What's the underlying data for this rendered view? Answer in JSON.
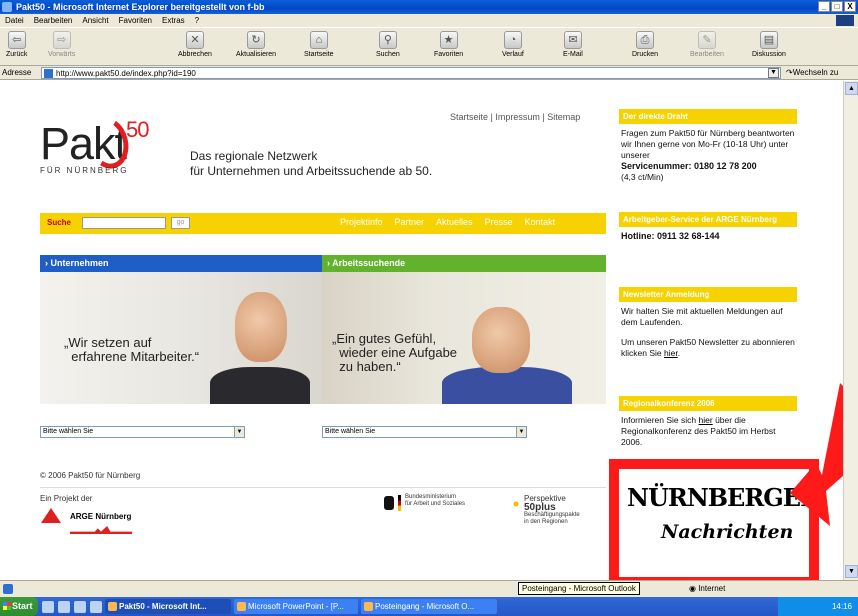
{
  "window": {
    "title": "Pakt50 - Microsoft Internet Explorer bereitgestellt von f-bb",
    "min": "_",
    "max": "□",
    "close": "X"
  },
  "menu": [
    "Datei",
    "Bearbeiten",
    "Ansicht",
    "Favoriten",
    "Extras",
    "?"
  ],
  "toolbar": {
    "back": "Zurück",
    "forward": "Vorwärts",
    "stop": "Abbrechen",
    "refresh": "Aktualisieren",
    "home": "Startseite",
    "search": "Suchen",
    "favorites": "Favoriten",
    "history": "Verlauf",
    "mail": "E-Mail",
    "print": "Drucken",
    "edit": "Bearbeiten",
    "discuss": "Diskussion"
  },
  "address": {
    "label": "Adresse",
    "url": "http://www.pakt50.de/index.php?id=190",
    "go": "Wechseln zu"
  },
  "page": {
    "toplinks": "Startseite | Impressum | Sitemap",
    "logo_text": "Pakt",
    "logo_sup": "50",
    "logo_sub": "FÜR NÜRNBERG",
    "tagline_1": "Das regionale Netzwerk",
    "tagline_2": "für Unternehmen und Arbeitssuchende ab 50.",
    "search_label": "Suche",
    "search_go": "go",
    "nav": [
      "Projektinfo",
      "Partner",
      "Aktuelles",
      "Presse",
      "Kontakt"
    ],
    "tab_left": "› Unternehmen",
    "tab_right": "› Arbeitssuchende",
    "quote_left": "„Wir setzen auf\n  erfahrene Mitarbeiter.“",
    "quote_right": "„Ein gutes Gefühl,\n  wieder eine Aufgabe\n  zu haben.“",
    "select_left": "Bitte wählen Sie",
    "select_right": "Bitte wählen Sie",
    "copyright": "© 2006 Pakt50 für Nürnberg",
    "projekt": "Ein Projekt der",
    "arge": "ARGE Nürnberg",
    "bm_1": "Bundesministerium",
    "bm_2": "für Arbeit und Soziales",
    "persp_1": "Perspektive",
    "persp_2": "50plus",
    "persp_3": "Beschäftigungspakte",
    "persp_4": "in den Regionen"
  },
  "right": {
    "draht_head": "Der direkte Draht",
    "draht_text_1": "Fragen zum Pakt50 für Nürnberg beantworten wir Ihnen gerne von Mo-Fr (10-18 Uhr) unter unserer",
    "draht_text_2": "Servicenummer: 0180 12 78 200",
    "draht_text_3": "(4,3 ct/Min)",
    "ag_head": "Arbeitgeber-Service der ARGE Nürnberg",
    "ag_hotline": "Hotline: 0911 32 68-144",
    "nl_head": "Newsletter Anmeldung",
    "nl_text_1": "Wir halten Sie mit aktuellen Meldungen auf dem Laufenden.",
    "nl_text_2": "Um unseren Pakt50 Newsletter zu abonnieren klicken Sie",
    "nl_link": "hier",
    "rk_head": "Regionalkonferenz 2006",
    "rk_text_1": "Informieren Sie sich",
    "rk_link": "hier",
    "rk_text_2": "über die Regionalkonferenz des Pakt50 im Herbst 2006.",
    "nn_title": "NÜRNBERGER",
    "nn_sub": "Nachrichten"
  },
  "status": {
    "zone": "Internet",
    "tooltip": "Posteingang - Microsoft Outlook"
  },
  "taskbar": {
    "start": "Start",
    "tasks": [
      "Pakt50 - Microsoft Int...",
      "Microsoft PowerPoint - [P...",
      "Posteingang - Microsoft O..."
    ],
    "clock": "14:16"
  },
  "colors": {
    "yellow": "#f5d200",
    "blue": "#1f5ec7",
    "green": "#63b22e",
    "red": "#ff1a1a"
  }
}
